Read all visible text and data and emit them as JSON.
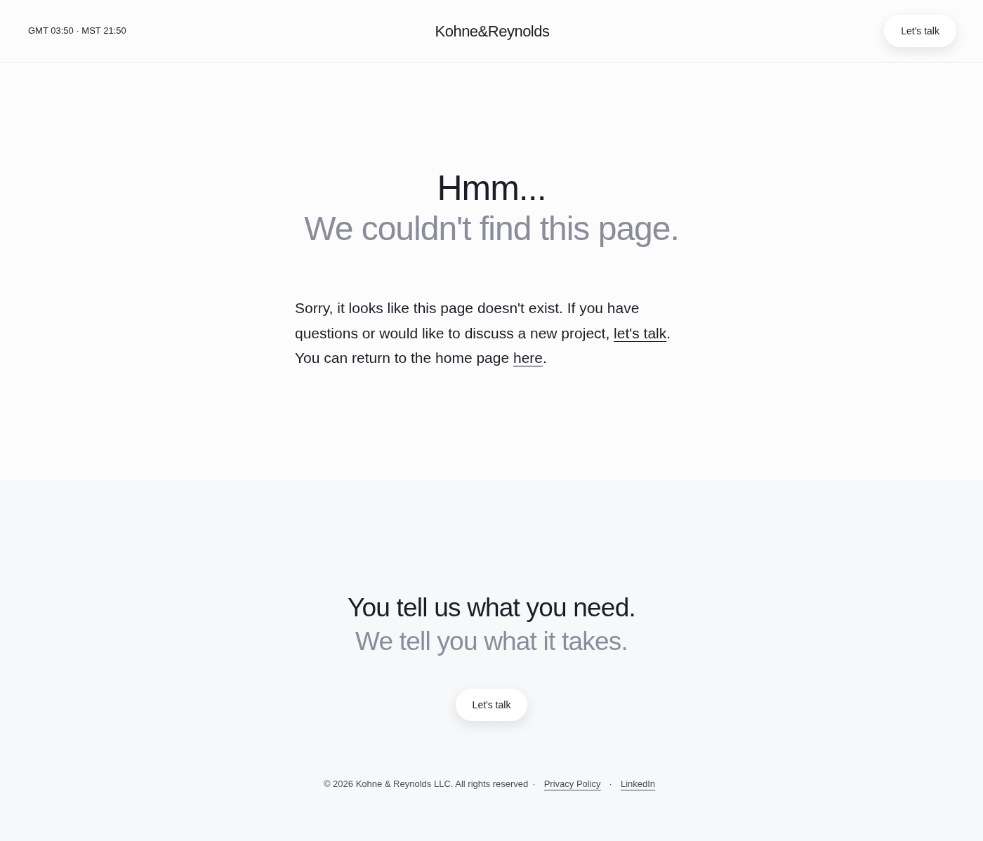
{
  "header": {
    "clock": "GMT 03:50 · MST 21:50",
    "logo": "Kohne&Reynolds",
    "cta": "Let's talk"
  },
  "not_found": {
    "title": "Hmm...",
    "subtitle": "We couldn't find this page.",
    "paragraph": [
      {
        "kind": "text",
        "text": "Sorry, it looks like this page doesn't exist. If you have questions or would like to discuss a new project, "
      },
      {
        "kind": "link",
        "text": "let's talk"
      },
      {
        "kind": "text",
        "text": ". You can return to the home page "
      },
      {
        "kind": "link",
        "text": "here"
      },
      {
        "kind": "text",
        "text": "."
      }
    ]
  },
  "contact": {
    "title": "You tell us what you need.",
    "subtitle": "We tell you what it takes.",
    "cta": "Let's talk"
  },
  "footer": [
    {
      "kind": "text",
      "text": "© 2026 Kohne & Reynolds LLC. All rights reserved"
    },
    {
      "kind": "separator",
      "text": "·"
    },
    {
      "kind": "link",
      "text": "Privacy Policy"
    },
    {
      "kind": "separator",
      "text": "·"
    },
    {
      "kind": "link",
      "text": "LinkedIn"
    }
  ]
}
